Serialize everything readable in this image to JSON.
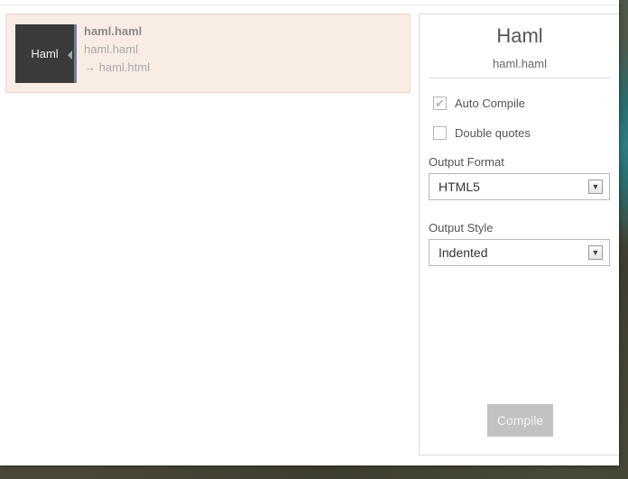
{
  "file": {
    "thumb_label": "Haml",
    "name": "haml.haml",
    "path": "haml.haml",
    "output": "→ haml.html"
  },
  "panel": {
    "title": "Haml",
    "subtitle": "haml.haml",
    "auto_compile": {
      "label": "Auto Compile",
      "checked": true
    },
    "double_quotes": {
      "label": "Double quotes",
      "checked": false
    },
    "output_format": {
      "label": "Output Format",
      "value": "HTML5"
    },
    "output_style": {
      "label": "Output Style",
      "value": "Indented"
    },
    "compile_label": "Compile"
  },
  "colors": {
    "item_bg": "#f9ece5",
    "thumb_bg": "#3a3a3a",
    "button_bg": "#c2c2c2"
  },
  "icons": {
    "check": "check-icon",
    "dropdown": "chevron-down-icon"
  }
}
